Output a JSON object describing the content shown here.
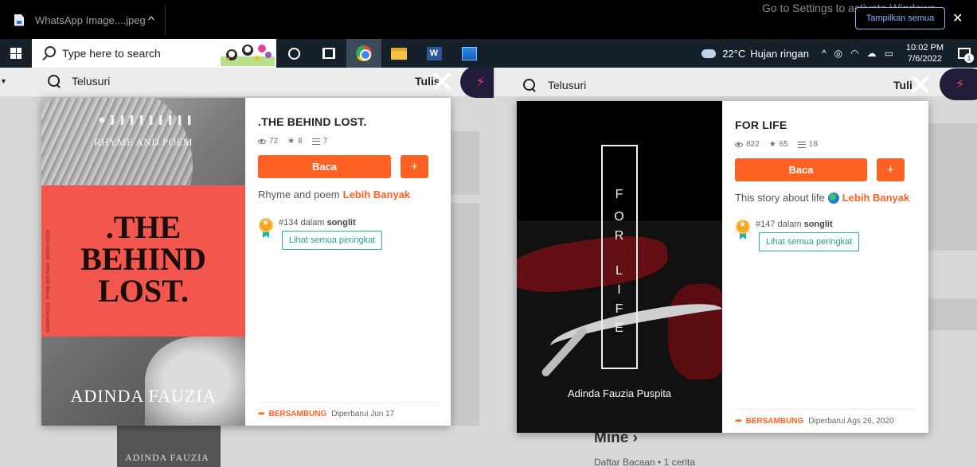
{
  "download_bar": {
    "file_name": "WhatsApp Image....jpeg",
    "activation_text": "Go to Settings to activate Windows.",
    "show_all": "Tampilkan semua",
    "close": "✕"
  },
  "taskbar": {
    "search_placeholder": "Type here to search",
    "word_letter": "W",
    "weather_temp": "22°C",
    "weather_desc": "Hujan ringan",
    "time": "10:02 PM",
    "date": "7/6/2022",
    "notification_count": "1"
  },
  "background_left": {
    "search_text": "Telusuri",
    "write_text": "Tulis",
    "cover_author": "ADINDA FAUZIA"
  },
  "background_right": {
    "search_text": "Telusuri",
    "write_text": "Tuli",
    "section_title": "Mine",
    "section_sub": "Daftar Bacaan • 1 cerita"
  },
  "story_left": {
    "cover_subtitle": "RHYME AND POEM",
    "cover_title": ".THE BEHIND LOST.",
    "cover_vertical": "ADINDA FAUZIA · RHYME AND POEM · ADINDA FAUZIA",
    "cover_author": "ADINDA FAUZIA",
    "title": ".THE BEHIND LOST.",
    "reads": "72",
    "votes": "8",
    "parts": "7",
    "read_label": "Baca",
    "add_label": "+",
    "description": "Rhyme and poem",
    "more_label": "Lebih Banyak",
    "rank_number": "#134",
    "rank_in": "dalam",
    "rank_tag": "songlit",
    "rank_button": "Lihat semua peringkat",
    "status_dots": "•••",
    "status": "BERSAMBUNG",
    "updated": "Diperbarui Jun 17"
  },
  "story_right": {
    "cover_letters": [
      "F",
      "O",
      "R",
      "L",
      "I",
      "F",
      "E"
    ],
    "cover_author": "Adinda Fauzia Puspita",
    "title": "FOR LIFE",
    "reads": "822",
    "votes": "65",
    "parts": "18",
    "read_label": "Baca",
    "add_label": "+",
    "description": "This story about life",
    "more_label": "Lebih Banyak",
    "rank_number": "#147",
    "rank_in": "dalam",
    "rank_tag": "songlit",
    "rank_button": "Lihat semua peringkat",
    "status_dots": "•••",
    "status": "BERSAMBUNG",
    "updated": "Diperbarui Ags 26, 2020"
  },
  "colors": {
    "accent": "#ff6122",
    "teal": "#1fb2a6",
    "cover_band": "#f2564c",
    "taskbar": "#15202b"
  },
  "icons": [
    "file-icon",
    "chevron-up-icon",
    "windows-icon",
    "search-icon",
    "cortana-icon",
    "task-view-icon",
    "chrome-icon",
    "file-explorer-icon",
    "word-icon",
    "photos-icon",
    "weather-icon",
    "eye-icon",
    "star-icon",
    "list-icon",
    "medal-icon",
    "globe-icon",
    "close-icon",
    "bolt-icon",
    "notification-icon"
  ]
}
